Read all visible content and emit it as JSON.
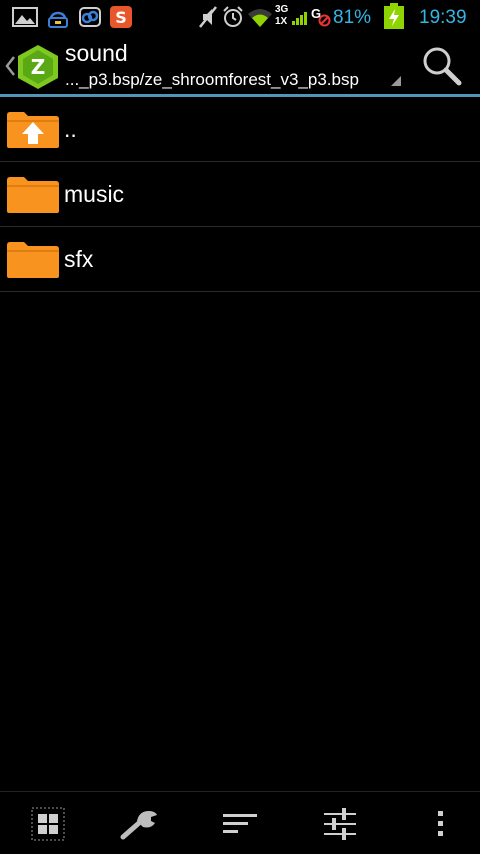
{
  "status_bar": {
    "icons": [
      "gallery-icon",
      "app-notification-icon",
      "link-icon",
      "sogou-input-icon",
      "mute-icon",
      "alarm-icon",
      "wifi-icon",
      "signal-3g-1x-icon",
      "gps-blocked-icon",
      "battery-charging-icon"
    ],
    "network_top": "3G",
    "network_bottom": "1X",
    "gps_label": "G",
    "battery_percent": "81%",
    "time": "19:39",
    "accent_color": "#33b5e5"
  },
  "titlebar": {
    "title": "sound",
    "path": "..._p3.bsp/ze_shroomforest_v3_p3.bsp",
    "logo_letter": "Z",
    "accent_color": "#4f96b8"
  },
  "files": [
    {
      "name": "..",
      "icon": "folder-up-icon"
    },
    {
      "name": "music",
      "icon": "folder-icon"
    },
    {
      "name": "sfx",
      "icon": "folder-icon"
    }
  ],
  "bottom_bar": {
    "buttons": [
      "grid-view-icon",
      "wrench-icon",
      "sort-icon",
      "filter-settings-icon",
      "more-vert-icon"
    ]
  },
  "colors": {
    "folder": "#f7931e",
    "background": "#000000"
  }
}
